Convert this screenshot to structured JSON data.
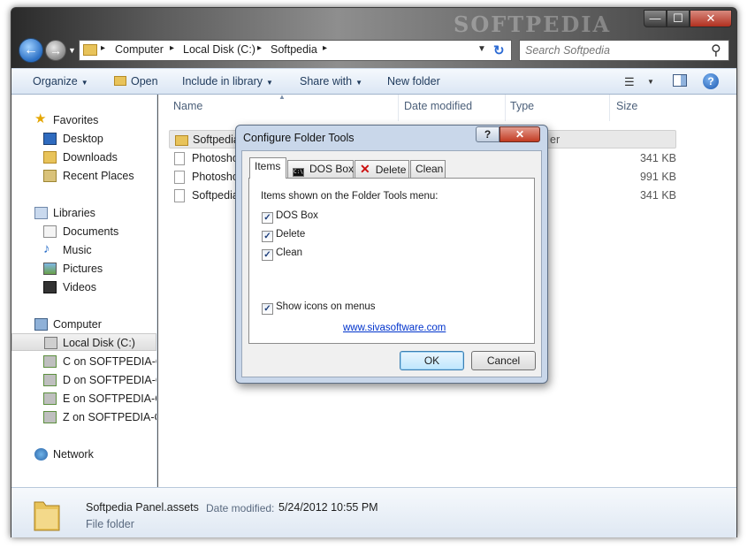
{
  "window": {
    "watermark": "SOFTPEDIA",
    "controls": {
      "minimize": "—",
      "maximize": "☐",
      "close": "✕"
    }
  },
  "address": {
    "crumbs": [
      "Computer",
      "Local Disk (C:)",
      "Softpedia"
    ],
    "separator": "▸"
  },
  "search": {
    "placeholder": "Search Softpedia"
  },
  "toolbar": {
    "organize": "Organize",
    "open": "Open",
    "include": "Include in library",
    "share": "Share with",
    "newfolder": "New folder"
  },
  "nav": {
    "favorites": "Favorites",
    "desktop": "Desktop",
    "downloads": "Downloads",
    "recent": "Recent Places",
    "libraries": "Libraries",
    "documents": "Documents",
    "music": "Music",
    "pictures": "Pictures",
    "videos": "Videos",
    "computer": "Computer",
    "localdisk": "Local Disk (C:)",
    "net_c": "C on SOFTPEDIA-OL",
    "net_d": "D on SOFTPEDIA-OL",
    "net_e": "E on SOFTPEDIA-OL",
    "net_z": "Z on SOFTPEDIA-OL",
    "network": "Network"
  },
  "columns": {
    "name": "Name",
    "date": "Date modified",
    "type": "Type",
    "size": "Size"
  },
  "files": [
    {
      "name": "Softpedia",
      "size": "",
      "type_suffix": "er"
    },
    {
      "name": "Photosho",
      "size": "341 KB"
    },
    {
      "name": "Photosho",
      "size": "991 KB"
    },
    {
      "name": "Softpedia",
      "size": "341 KB"
    }
  ],
  "details": {
    "name": "Softpedia Panel.assets",
    "date_label": "Date modified:",
    "date": "5/24/2012 10:55 PM",
    "type": "File folder"
  },
  "dialog": {
    "title": "Configure Folder Tools",
    "help": "?",
    "close": "✕",
    "tabs": {
      "items": "Items",
      "dosbox": "DOS Box",
      "delete": "Delete",
      "clean": "Clean"
    },
    "items_label": "Items shown on the Folder Tools menu:",
    "options": {
      "dosbox": "DOS Box",
      "delete": "Delete",
      "clean": "Clean",
      "show_icons": "Show icons on menus"
    },
    "link": "www.sivasoftware.com",
    "ok": "OK",
    "cancel": "Cancel"
  }
}
